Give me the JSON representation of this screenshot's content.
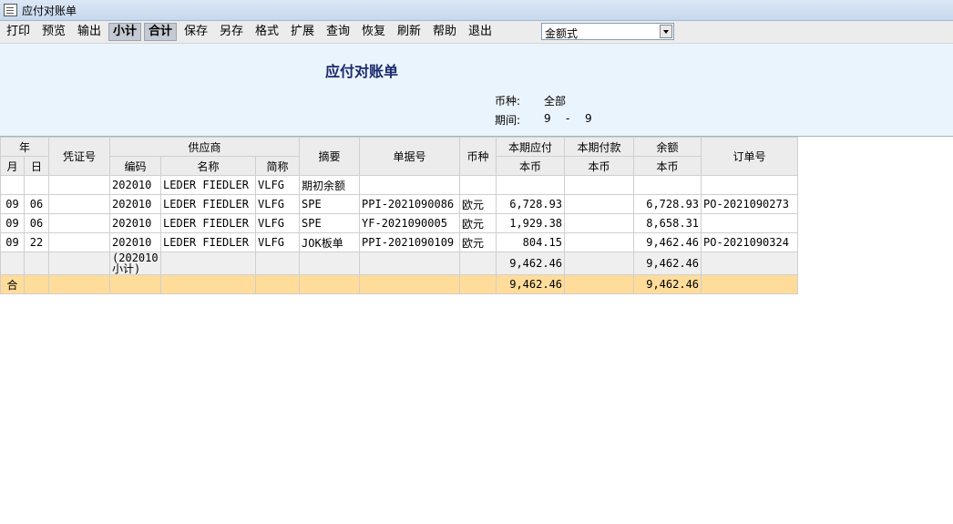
{
  "window": {
    "title": "应付对账单"
  },
  "toolbar": {
    "buttons": [
      "打印",
      "预览",
      "输出",
      "小计",
      "合计",
      "保存",
      "另存",
      "格式",
      "扩展",
      "查询",
      "恢复",
      "刷新",
      "帮助",
      "退出"
    ],
    "format_select": "金额式"
  },
  "report": {
    "title": "应付对账单",
    "currency_label": "币种:",
    "currency_value": "全部",
    "period_label": "期间:",
    "period_from": "9",
    "period_sep": "-",
    "period_to": "9"
  },
  "table": {
    "headers": {
      "year": "年",
      "month": "月",
      "day": "日",
      "voucher": "凭证号",
      "supplier": "供应商",
      "supplier_code": "编码",
      "supplier_name": "名称",
      "supplier_abbr": "简称",
      "summary": "摘要",
      "doc_no": "单据号",
      "currency": "币种",
      "payable": "本期应付",
      "payable_sub": "本币",
      "paid": "本期付款",
      "paid_sub": "本币",
      "balance": "余额",
      "balance_sub": "本币",
      "order": "订单号"
    },
    "rows": [
      {
        "month": "",
        "day": "",
        "voucher": "",
        "code": "202010",
        "name": "LEDER FIEDLER",
        "abbr": "VLFG",
        "summary": "期初余额",
        "doc": "",
        "cur": "",
        "payable": "",
        "paid": "",
        "balance": "",
        "order": ""
      },
      {
        "month": "09",
        "day": "06",
        "voucher": "",
        "code": "202010",
        "name": "LEDER FIEDLER",
        "abbr": "VLFG",
        "summary": "SPE",
        "doc": "PPI-2021090086",
        "cur": "欧元",
        "payable": "6,728.93",
        "paid": "",
        "balance": "6,728.93",
        "order": "PO-2021090273"
      },
      {
        "month": "09",
        "day": "06",
        "voucher": "",
        "code": "202010",
        "name": "LEDER FIEDLER",
        "abbr": "VLFG",
        "summary": "SPE",
        "doc": "YF-2021090005",
        "cur": "欧元",
        "payable": "1,929.38",
        "paid": "",
        "balance": "8,658.31",
        "order": ""
      },
      {
        "month": "09",
        "day": "22",
        "voucher": "",
        "code": "202010",
        "name": "LEDER FIEDLER",
        "abbr": "VLFG",
        "summary": "JOK板单",
        "doc": "PPI-2021090109",
        "cur": "欧元",
        "payable": "804.15",
        "paid": "",
        "balance": "9,462.46",
        "order": "PO-2021090324"
      }
    ],
    "subtotal": {
      "code": "(202010小计)",
      "payable": "9,462.46",
      "balance": "9,462.46"
    },
    "total": {
      "label": "合",
      "payable": "9,462.46",
      "balance": "9,462.46"
    }
  }
}
